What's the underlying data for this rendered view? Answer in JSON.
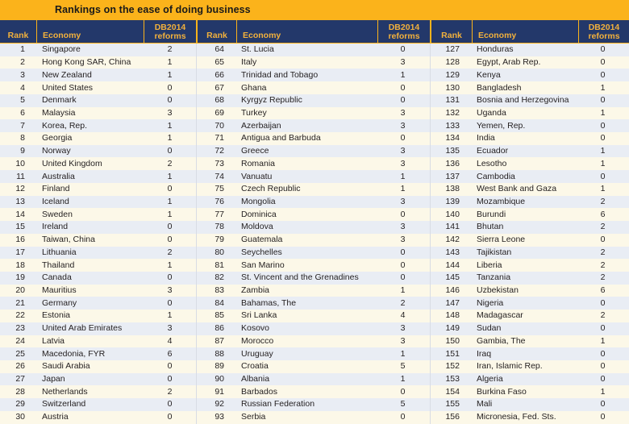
{
  "title": "Rankings on the ease of doing business",
  "colors": {
    "title_bar": "#FBB31B",
    "header_bg": "#23386A",
    "header_text": "#F2B13C",
    "row_odd": "#E9EDF4",
    "row_even": "#FCF8E8",
    "body_text": "#231F20"
  },
  "columns": {
    "rank": "Rank",
    "economy": "Economy",
    "reforms_line1": "DB2014",
    "reforms_line2": "reforms"
  },
  "blocks": [
    {
      "id": "block-1",
      "rows": [
        {
          "rank": "1",
          "economy": "Singapore",
          "reforms": "2"
        },
        {
          "rank": "2",
          "economy": "Hong Kong SAR, China",
          "reforms": "1"
        },
        {
          "rank": "3",
          "economy": "New Zealand",
          "reforms": "1"
        },
        {
          "rank": "4",
          "economy": "United States",
          "reforms": "0"
        },
        {
          "rank": "5",
          "economy": "Denmark",
          "reforms": "0"
        },
        {
          "rank": "6",
          "economy": "Malaysia",
          "reforms": "3"
        },
        {
          "rank": "7",
          "economy": "Korea, Rep.",
          "reforms": "1"
        },
        {
          "rank": "8",
          "economy": "Georgia",
          "reforms": "1"
        },
        {
          "rank": "9",
          "economy": "Norway",
          "reforms": "0"
        },
        {
          "rank": "10",
          "economy": "United Kingdom",
          "reforms": "2"
        },
        {
          "rank": "11",
          "economy": "Australia",
          "reforms": "1"
        },
        {
          "rank": "12",
          "economy": "Finland",
          "reforms": "0"
        },
        {
          "rank": "13",
          "economy": "Iceland",
          "reforms": "1"
        },
        {
          "rank": "14",
          "economy": "Sweden",
          "reforms": "1"
        },
        {
          "rank": "15",
          "economy": "Ireland",
          "reforms": "0"
        },
        {
          "rank": "16",
          "economy": "Taiwan, China",
          "reforms": "0"
        },
        {
          "rank": "17",
          "economy": "Lithuania",
          "reforms": "2"
        },
        {
          "rank": "18",
          "economy": "Thailand",
          "reforms": "1"
        },
        {
          "rank": "19",
          "economy": "Canada",
          "reforms": "0"
        },
        {
          "rank": "20",
          "economy": "Mauritius",
          "reforms": "3"
        },
        {
          "rank": "21",
          "economy": "Germany",
          "reforms": "0"
        },
        {
          "rank": "22",
          "economy": "Estonia",
          "reforms": "1"
        },
        {
          "rank": "23",
          "economy": "United Arab Emirates",
          "reforms": "3"
        },
        {
          "rank": "24",
          "economy": "Latvia",
          "reforms": "4"
        },
        {
          "rank": "25",
          "economy": "Macedonia, FYR",
          "reforms": "6"
        },
        {
          "rank": "26",
          "economy": "Saudi Arabia",
          "reforms": "0"
        },
        {
          "rank": "27",
          "economy": "Japan",
          "reforms": "0"
        },
        {
          "rank": "28",
          "economy": "Netherlands",
          "reforms": "2"
        },
        {
          "rank": "29",
          "economy": "Switzerland",
          "reforms": "0"
        },
        {
          "rank": "30",
          "economy": "Austria",
          "reforms": "0"
        }
      ]
    },
    {
      "id": "block-2",
      "rows": [
        {
          "rank": "64",
          "economy": "St. Lucia",
          "reforms": "0"
        },
        {
          "rank": "65",
          "economy": "Italy",
          "reforms": "3"
        },
        {
          "rank": "66",
          "economy": "Trinidad and Tobago",
          "reforms": "1"
        },
        {
          "rank": "67",
          "economy": "Ghana",
          "reforms": "0"
        },
        {
          "rank": "68",
          "economy": "Kyrgyz Republic",
          "reforms": "0"
        },
        {
          "rank": "69",
          "economy": "Turkey",
          "reforms": "3"
        },
        {
          "rank": "70",
          "economy": "Azerbaijan",
          "reforms": "3"
        },
        {
          "rank": "71",
          "economy": "Antigua and Barbuda",
          "reforms": "0"
        },
        {
          "rank": "72",
          "economy": "Greece",
          "reforms": "3"
        },
        {
          "rank": "73",
          "economy": "Romania",
          "reforms": "3"
        },
        {
          "rank": "74",
          "economy": "Vanuatu",
          "reforms": "1"
        },
        {
          "rank": "75",
          "economy": "Czech Republic",
          "reforms": "1"
        },
        {
          "rank": "76",
          "economy": "Mongolia",
          "reforms": "3"
        },
        {
          "rank": "77",
          "economy": "Dominica",
          "reforms": "0"
        },
        {
          "rank": "78",
          "economy": "Moldova",
          "reforms": "3"
        },
        {
          "rank": "79",
          "economy": "Guatemala",
          "reforms": "3"
        },
        {
          "rank": "80",
          "economy": "Seychelles",
          "reforms": "0"
        },
        {
          "rank": "81",
          "economy": "San Marino",
          "reforms": "0"
        },
        {
          "rank": "82",
          "economy": "St. Vincent and the Grenadines",
          "reforms": "0"
        },
        {
          "rank": "83",
          "economy": "Zambia",
          "reforms": "1"
        },
        {
          "rank": "84",
          "economy": "Bahamas, The",
          "reforms": "2"
        },
        {
          "rank": "85",
          "economy": "Sri Lanka",
          "reforms": "4"
        },
        {
          "rank": "86",
          "economy": "Kosovo",
          "reforms": "3"
        },
        {
          "rank": "87",
          "economy": "Morocco",
          "reforms": "3"
        },
        {
          "rank": "88",
          "economy": "Uruguay",
          "reforms": "1"
        },
        {
          "rank": "89",
          "economy": "Croatia",
          "reforms": "5"
        },
        {
          "rank": "90",
          "economy": "Albania",
          "reforms": "1"
        },
        {
          "rank": "91",
          "economy": "Barbados",
          "reforms": "0"
        },
        {
          "rank": "92",
          "economy": "Russian Federation",
          "reforms": "5"
        },
        {
          "rank": "93",
          "economy": "Serbia",
          "reforms": "0"
        }
      ]
    },
    {
      "id": "block-3",
      "rows": [
        {
          "rank": "127",
          "economy": "Honduras",
          "reforms": "0"
        },
        {
          "rank": "128",
          "economy": "Egypt, Arab Rep.",
          "reforms": "0"
        },
        {
          "rank": "129",
          "economy": "Kenya",
          "reforms": "0"
        },
        {
          "rank": "130",
          "economy": "Bangladesh",
          "reforms": "1"
        },
        {
          "rank": "131",
          "economy": "Bosnia and Herzegovina",
          "reforms": "0"
        },
        {
          "rank": "132",
          "economy": "Uganda",
          "reforms": "1"
        },
        {
          "rank": "133",
          "economy": "Yemen, Rep.",
          "reforms": "0"
        },
        {
          "rank": "134",
          "economy": "India",
          "reforms": "0"
        },
        {
          "rank": "135",
          "economy": "Ecuador",
          "reforms": "1"
        },
        {
          "rank": "136",
          "economy": "Lesotho",
          "reforms": "1"
        },
        {
          "rank": "137",
          "economy": "Cambodia",
          "reforms": "0"
        },
        {
          "rank": "138",
          "economy": "West Bank and Gaza",
          "reforms": "1"
        },
        {
          "rank": "139",
          "economy": "Mozambique",
          "reforms": "2"
        },
        {
          "rank": "140",
          "economy": "Burundi",
          "reforms": "6"
        },
        {
          "rank": "141",
          "economy": "Bhutan",
          "reforms": "2"
        },
        {
          "rank": "142",
          "economy": "Sierra Leone",
          "reforms": "0"
        },
        {
          "rank": "143",
          "economy": "Tajikistan",
          "reforms": "2"
        },
        {
          "rank": "144",
          "economy": "Liberia",
          "reforms": "2"
        },
        {
          "rank": "145",
          "economy": "Tanzania",
          "reforms": "2"
        },
        {
          "rank": "146",
          "economy": "Uzbekistan",
          "reforms": "6"
        },
        {
          "rank": "147",
          "economy": "Nigeria",
          "reforms": "0"
        },
        {
          "rank": "148",
          "economy": "Madagascar",
          "reforms": "2"
        },
        {
          "rank": "149",
          "economy": "Sudan",
          "reforms": "0"
        },
        {
          "rank": "150",
          "economy": "Gambia, The",
          "reforms": "1"
        },
        {
          "rank": "151",
          "economy": "Iraq",
          "reforms": "0"
        },
        {
          "rank": "152",
          "economy": "Iran, Islamic Rep.",
          "reforms": "0"
        },
        {
          "rank": "153",
          "economy": "Algeria",
          "reforms": "0"
        },
        {
          "rank": "154",
          "economy": "Burkina Faso",
          "reforms": "1"
        },
        {
          "rank": "155",
          "economy": "Mali",
          "reforms": "0"
        },
        {
          "rank": "156",
          "economy": "Micronesia, Fed. Sts.",
          "reforms": "0"
        }
      ]
    }
  ]
}
